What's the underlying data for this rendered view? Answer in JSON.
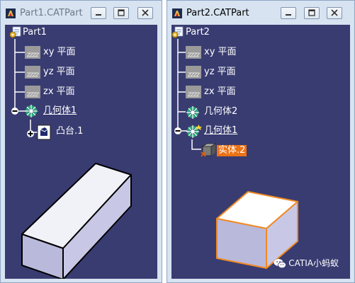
{
  "windows": [
    {
      "title": "Part1.CATPart",
      "tree": {
        "root": "Part1",
        "planes": [
          "xy 平面",
          "yz 平面",
          "zx 平面"
        ],
        "body": "几何体1",
        "feature": "凸台.1"
      }
    },
    {
      "title": "Part2.CATPart",
      "tree": {
        "root": "Part2",
        "planes": [
          "xy 平面",
          "yz 平面",
          "zx 平面"
        ],
        "body2": "几何体2",
        "body1": "几何体1",
        "solid": "实体.2"
      }
    }
  ],
  "watermark": "CATIA小蚂蚁",
  "colors": {
    "viewport_bg": "#393c71",
    "window_frame": "#d7e3f1",
    "highlight": "#ec7216",
    "solid_face": "#c9c9e6"
  },
  "icons": [
    "catia-app-icon",
    "minimize-icon",
    "maximize-icon",
    "close-icon",
    "part-icon",
    "plane-icon",
    "body-icon",
    "pad-icon",
    "solid-icon",
    "expand-icon",
    "collapse-icon",
    "wechat-icon"
  ]
}
